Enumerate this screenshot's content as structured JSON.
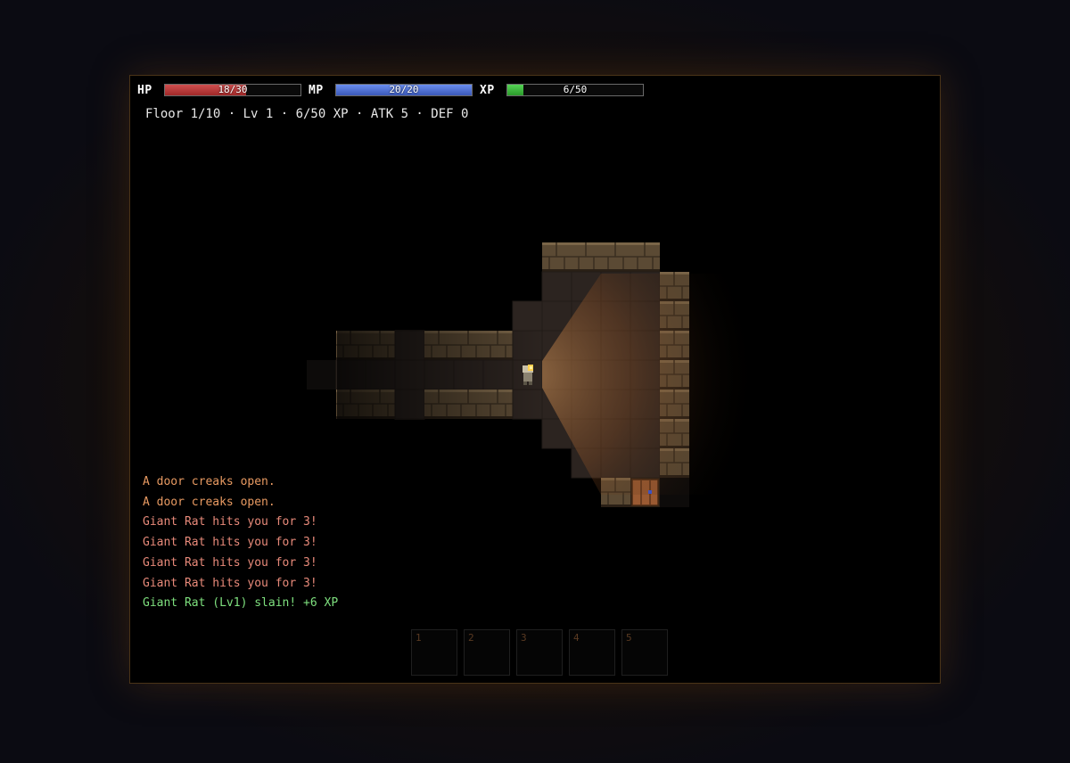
{
  "hud": {
    "hp": {
      "label": "HP",
      "text": "18/30",
      "fraction": 0.6,
      "color": "#c03a3a"
    },
    "mp": {
      "label": "MP",
      "text": "20/20",
      "fraction": 1.0,
      "color": "#4a6fd8"
    },
    "xp": {
      "label": "XP",
      "text": "6/50",
      "fraction": 0.12,
      "color": "#3ab83a"
    }
  },
  "status_line": "Floor 1/10 · Lv 1 · 6/50 XP · ATK 5 · DEF 0",
  "message_log": [
    {
      "text": "A door creaks open.",
      "kind": "door"
    },
    {
      "text": "A door creaks open.",
      "kind": "door"
    },
    {
      "text": "Giant Rat hits you for 3!",
      "kind": "hit"
    },
    {
      "text": "Giant Rat hits you for 3!",
      "kind": "hit"
    },
    {
      "text": "Giant Rat hits you for 3!",
      "kind": "hit"
    },
    {
      "text": "Giant Rat hits you for 3!",
      "kind": "hit"
    },
    {
      "text": "Giant Rat (Lv1) slain! +6 XP",
      "kind": "slain"
    }
  ],
  "hotbar": {
    "slots": [
      {
        "number": "1"
      },
      {
        "number": "2"
      },
      {
        "number": "3"
      },
      {
        "number": "4"
      },
      {
        "number": "5"
      }
    ]
  },
  "map": {
    "tiles": [
      {
        "t": "wall",
        "c": 14,
        "r": 5
      },
      {
        "t": "wall",
        "c": 15,
        "r": 5
      },
      {
        "t": "wall",
        "c": 16,
        "r": 5
      },
      {
        "t": "wall",
        "c": 17,
        "r": 5
      },
      {
        "t": "floor",
        "c": 14,
        "r": 6
      },
      {
        "t": "floor",
        "c": 15,
        "r": 6
      },
      {
        "t": "floor",
        "c": 16,
        "r": 6
      },
      {
        "t": "floor",
        "c": 17,
        "r": 6
      },
      {
        "t": "wall",
        "c": 18,
        "r": 6
      },
      {
        "t": "floor",
        "c": 13,
        "r": 7
      },
      {
        "t": "floor",
        "c": 14,
        "r": 7
      },
      {
        "t": "floor",
        "c": 15,
        "r": 7
      },
      {
        "t": "floor",
        "c": 16,
        "r": 7
      },
      {
        "t": "floor",
        "c": 17,
        "r": 7
      },
      {
        "t": "wall",
        "c": 18,
        "r": 7
      },
      {
        "t": "wall",
        "c": 7,
        "r": 8
      },
      {
        "t": "wall",
        "c": 8,
        "r": 8
      },
      {
        "t": "floor",
        "c": 9,
        "r": 8
      },
      {
        "t": "wall",
        "c": 10,
        "r": 8
      },
      {
        "t": "wall",
        "c": 11,
        "r": 8
      },
      {
        "t": "wall",
        "c": 12,
        "r": 8
      },
      {
        "t": "floor",
        "c": 13,
        "r": 8
      },
      {
        "t": "floor",
        "c": 14,
        "r": 8
      },
      {
        "t": "floor",
        "c": 15,
        "r": 8
      },
      {
        "t": "floor",
        "c": 16,
        "r": 8
      },
      {
        "t": "floor",
        "c": 17,
        "r": 8
      },
      {
        "t": "wall",
        "c": 18,
        "r": 8
      },
      {
        "t": "dark",
        "c": 6,
        "r": 9
      },
      {
        "t": "floor",
        "c": 7,
        "r": 9
      },
      {
        "t": "floor",
        "c": 8,
        "r": 9
      },
      {
        "t": "floor",
        "c": 9,
        "r": 9
      },
      {
        "t": "floor",
        "c": 10,
        "r": 9
      },
      {
        "t": "floor",
        "c": 11,
        "r": 9
      },
      {
        "t": "floor",
        "c": 12,
        "r": 9
      },
      {
        "t": "floor",
        "c": 13,
        "r": 9
      },
      {
        "t": "floor",
        "c": 14,
        "r": 9
      },
      {
        "t": "floor",
        "c": 15,
        "r": 9
      },
      {
        "t": "floor",
        "c": 16,
        "r": 9
      },
      {
        "t": "floor",
        "c": 17,
        "r": 9
      },
      {
        "t": "wall",
        "c": 18,
        "r": 9
      },
      {
        "t": "wall",
        "c": 7,
        "r": 10
      },
      {
        "t": "wall",
        "c": 8,
        "r": 10
      },
      {
        "t": "floor",
        "c": 9,
        "r": 10
      },
      {
        "t": "wall",
        "c": 10,
        "r": 10
      },
      {
        "t": "wall",
        "c": 11,
        "r": 10
      },
      {
        "t": "wall",
        "c": 12,
        "r": 10
      },
      {
        "t": "floor",
        "c": 13,
        "r": 10
      },
      {
        "t": "floor",
        "c": 14,
        "r": 10
      },
      {
        "t": "floor",
        "c": 15,
        "r": 10
      },
      {
        "t": "floor",
        "c": 16,
        "r": 10
      },
      {
        "t": "floor",
        "c": 17,
        "r": 10
      },
      {
        "t": "wall",
        "c": 18,
        "r": 10
      },
      {
        "t": "floor",
        "c": 14,
        "r": 11
      },
      {
        "t": "floor",
        "c": 15,
        "r": 11
      },
      {
        "t": "floor",
        "c": 16,
        "r": 11
      },
      {
        "t": "floor",
        "c": 17,
        "r": 11
      },
      {
        "t": "wall",
        "c": 18,
        "r": 11
      },
      {
        "t": "floor",
        "c": 15,
        "r": 12
      },
      {
        "t": "floor",
        "c": 16,
        "r": 12
      },
      {
        "t": "floor",
        "c": 17,
        "r": 12
      },
      {
        "t": "wall",
        "c": 18,
        "r": 12
      },
      {
        "t": "wall",
        "c": 16,
        "r": 13
      },
      {
        "t": "door",
        "c": 17,
        "r": 13
      },
      {
        "t": "dark",
        "c": 18,
        "r": 13
      }
    ],
    "player": {
      "c": 13,
      "r": 9
    }
  }
}
